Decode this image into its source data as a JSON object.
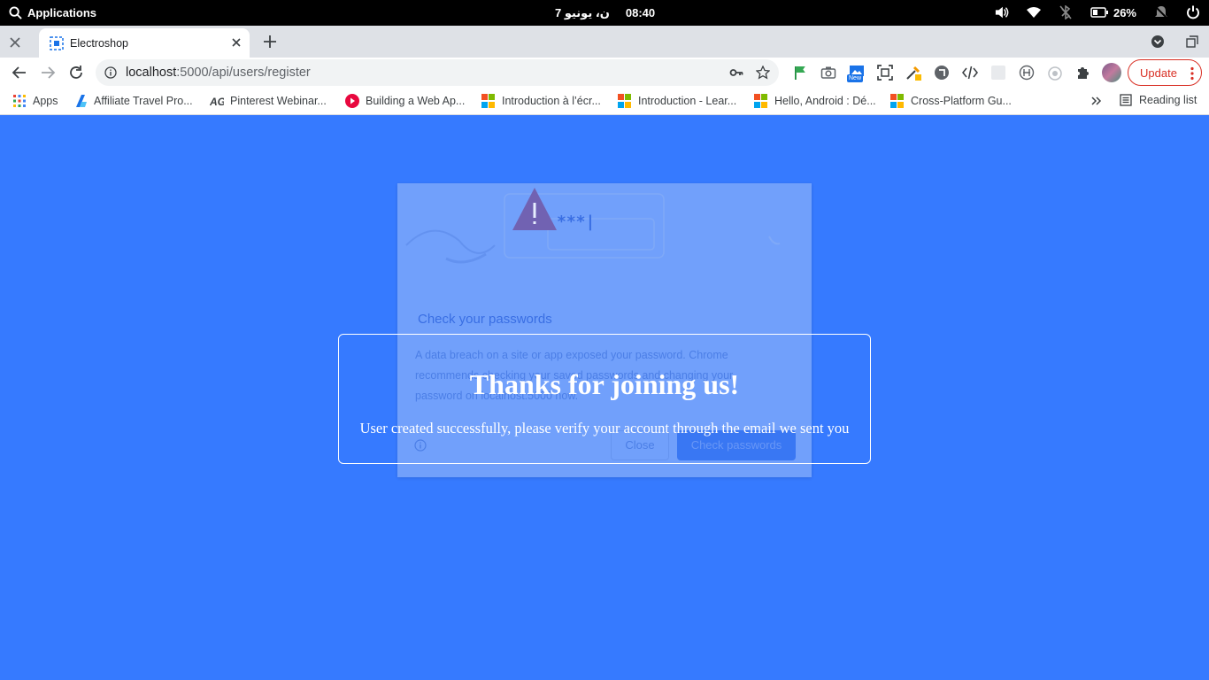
{
  "os_bar": {
    "applications_label": "Applications",
    "date": "ن، يونيو 7",
    "time": "08:40",
    "battery": "26%"
  },
  "tab": {
    "title": "Electroshop"
  },
  "address_bar": {
    "host": "localhost",
    "path": ":5000/api/users/register"
  },
  "extensions": {
    "new_badge": "New"
  },
  "update_button": {
    "label": "Update"
  },
  "bookmarks": {
    "apps": "Apps",
    "items": [
      "Affiliate Travel Pro...",
      "Pinterest Webinar...",
      "Building a Web Ap...",
      "Introduction à l’écr...",
      "Introduction - Lear...",
      "Hello, Android : Dé...",
      "Cross-Platform Gu..."
    ],
    "reading_list": "Reading list"
  },
  "password_dialog": {
    "title": "Check your passwords",
    "body": "A data breach on a site or app exposed your password. Chrome recommends checking your saved passwords and changing your password on localhost:5000 now.",
    "close_label": "Close",
    "check_label": "Check passwords",
    "illustration_text": "***|"
  },
  "message_card": {
    "heading": "Thanks for joining us!",
    "body": "User created successfully, please verify your account through the email we sent you"
  },
  "colors": {
    "page_background": "#367aff",
    "update_accent": "#d93025",
    "os_bar": "#000000"
  }
}
